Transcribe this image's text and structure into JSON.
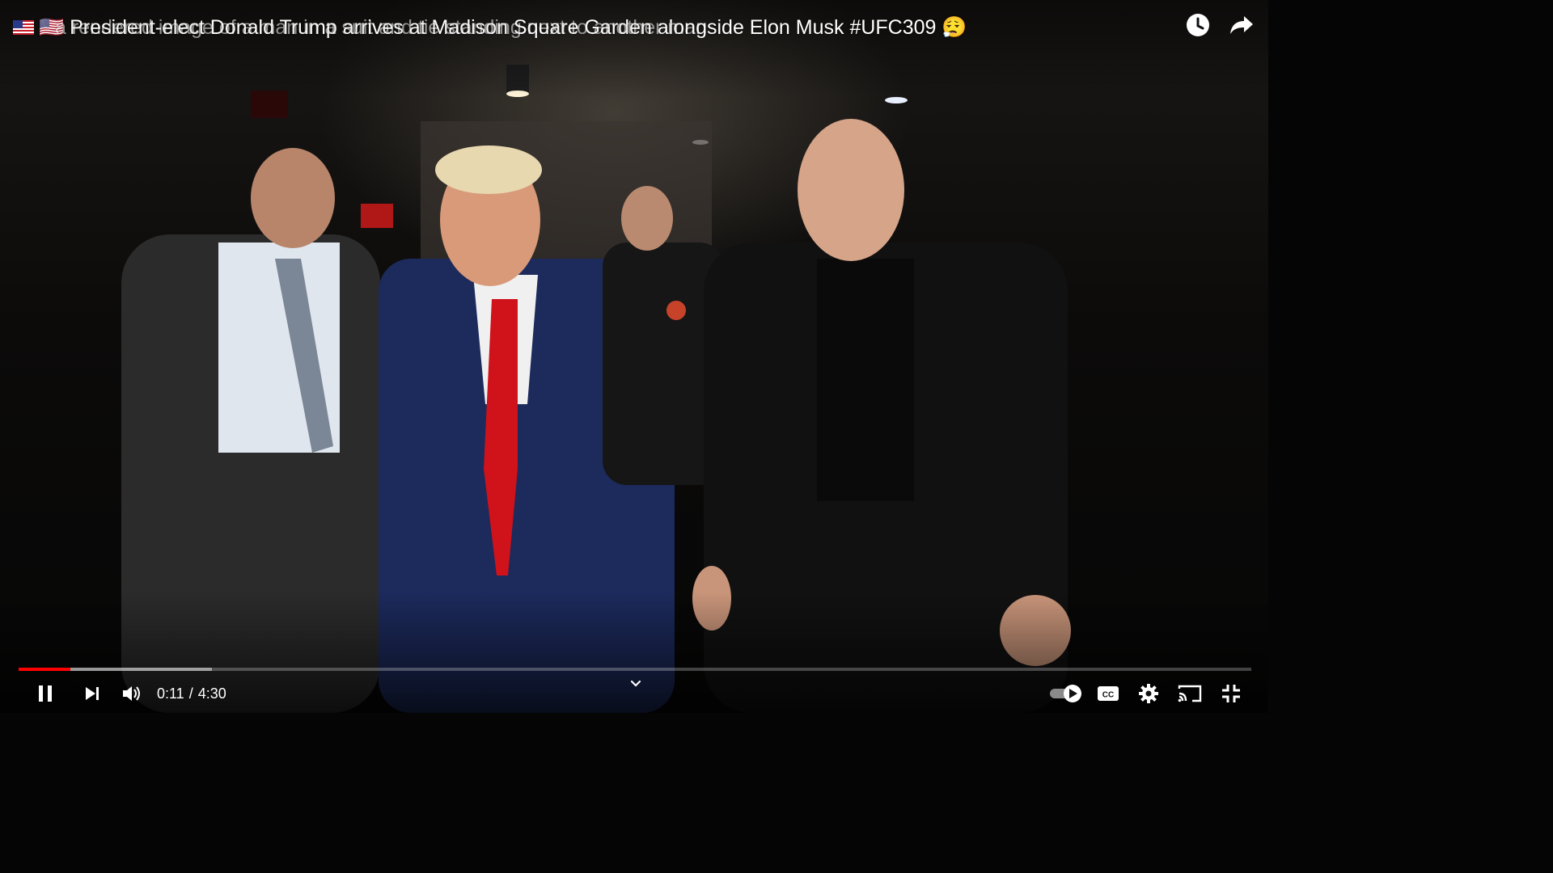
{
  "video": {
    "title_overlay_primary": "🇺🇸 President-elect Donald Trump arrives at Madison Square Garden alongside Elon Musk #UFC309 😮‍💨",
    "title_overlay_secondary": "a rendered image of a man in a suit and tie standing next to another man",
    "flag_icon": "us-flag-icon",
    "progress": {
      "played_fraction": 0.042,
      "buffered_fraction": 0.157
    },
    "time": {
      "current": "0:11",
      "separator": "/",
      "duration": "4:30"
    },
    "accent_color": "#ff0000"
  },
  "top_actions": [
    {
      "name": "watch-later",
      "icon": "clock-icon"
    },
    {
      "name": "share",
      "icon": "share-arrow-icon"
    }
  ],
  "controls": {
    "left": [
      "pause-icon",
      "next-icon",
      "volume-icon"
    ],
    "right": [
      "autoplay-toggle-icon",
      "captions-icon",
      "settings-icon",
      "cast-icon",
      "exit-fullscreen-icon"
    ],
    "captions_label": "CC"
  }
}
